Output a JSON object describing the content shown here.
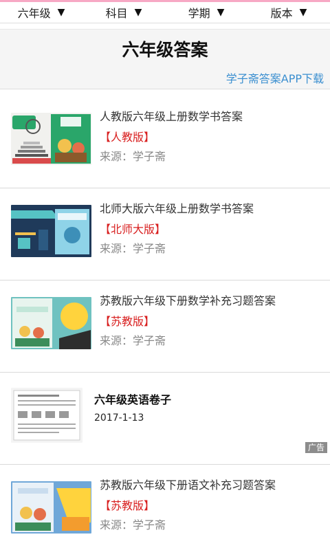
{
  "filters": [
    {
      "label": "六年级",
      "icon": "caret-down-icon"
    },
    {
      "label": "科目",
      "icon": "caret-down-icon"
    },
    {
      "label": "学期",
      "icon": "caret-down-icon"
    },
    {
      "label": "版本",
      "icon": "caret-down-icon"
    }
  ],
  "caret_glyph": "▼",
  "header": {
    "title": "六年级答案",
    "app_link": "学子斋答案APP下载"
  },
  "items": [
    {
      "title": "人教版六年级上册数学书答案",
      "tag": "【人教版】",
      "source": "来源：学子斋",
      "thumb_colors": {
        "bg": "#f1f1ee",
        "accent": "#2aa66a"
      }
    },
    {
      "title": "北师大版六年级上册数学书答案",
      "tag": "【北师大版】",
      "source": "来源：学子斋",
      "thumb_colors": {
        "bg": "#1f3a5a",
        "accent": "#56c3c4"
      }
    },
    {
      "title": "苏教版六年级下册数学补充习题答案",
      "tag": "【苏教版】",
      "source": "来源：学子斋",
      "thumb_colors": {
        "bg": "#6fc2c0",
        "accent": "#ffd33d"
      }
    }
  ],
  "ad": {
    "title": "六年级英语卷子",
    "date": "2017-1-13",
    "badge": "广告"
  },
  "item_last": {
    "title": "苏教版六年级下册语文补充习题答案",
    "tag": "【苏教版】",
    "source": "来源：学子斋",
    "thumb_colors": {
      "bg": "#6fa7d8",
      "accent": "#ffd33d"
    }
  },
  "colors": {
    "accent_pink": "#f7a8c4",
    "link_blue": "#3b8fd0",
    "tag_red": "#d81e1e",
    "muted_gray": "#888888"
  }
}
